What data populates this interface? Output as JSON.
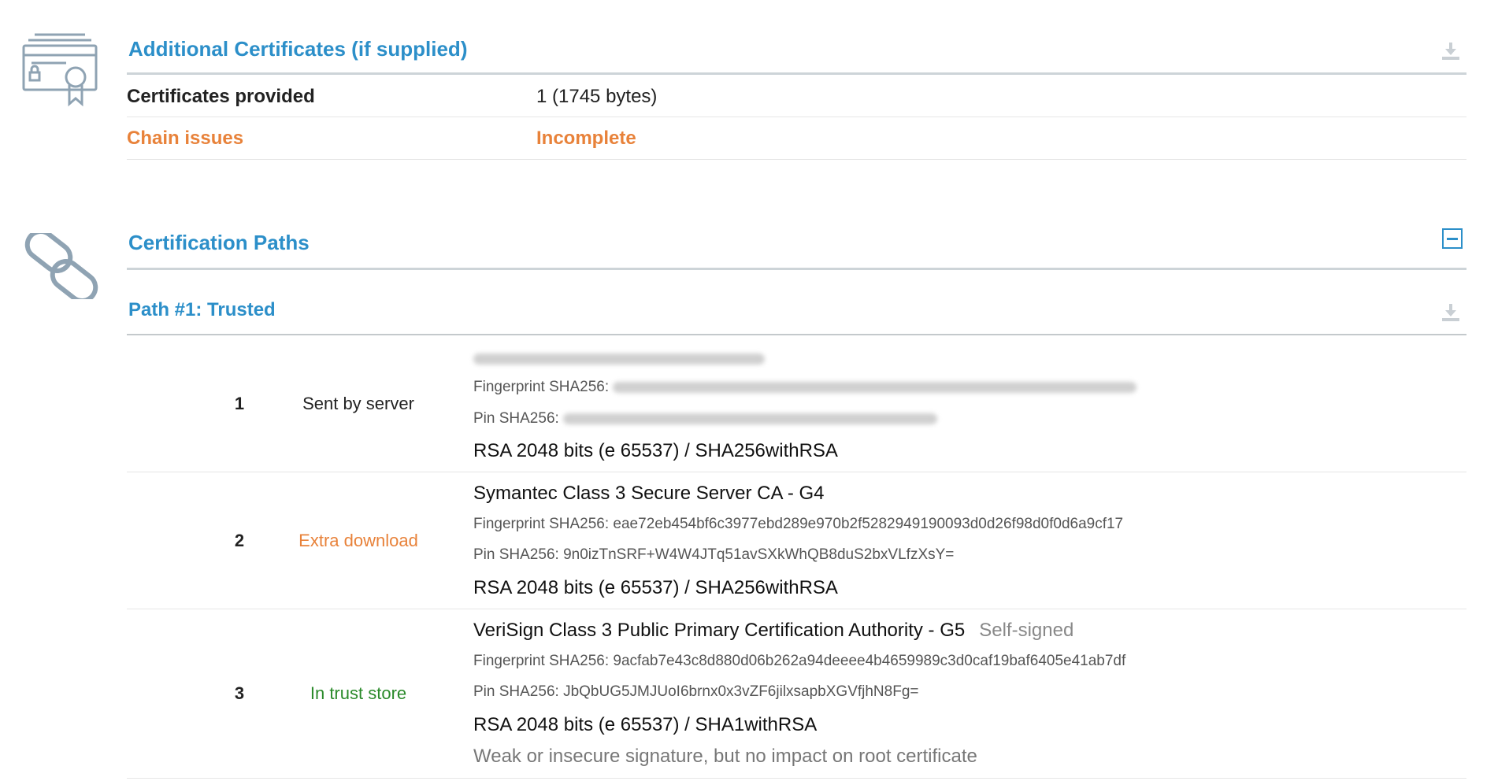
{
  "additional_certificates": {
    "title": "Additional Certificates (if supplied)",
    "rows": [
      {
        "label": "Certificates provided",
        "value": "1 (1745 bytes)"
      },
      {
        "label": "Chain issues",
        "value": "Incomplete"
      }
    ]
  },
  "certification_paths": {
    "title": "Certification Paths",
    "path_title": "Path #1: Trusted",
    "certs": [
      {
        "num": "1",
        "source": "Sent by server",
        "fingerprint_label": "Fingerprint SHA256:",
        "pin_label": "Pin SHA256:",
        "algo": "RSA 2048 bits (e 65537) / SHA256withRSA"
      },
      {
        "num": "2",
        "source": "Extra download",
        "name": "Symantec Class 3 Secure Server CA - G4",
        "fingerprint": "Fingerprint SHA256: eae72eb454bf6c3977ebd289e970b2f5282949190093d0d26f98d0f0d6a9cf17",
        "pin": "Pin SHA256: 9n0izTnSRF+W4W4JTq51avSXkWhQB8duS2bxVLfzXsY=",
        "algo": "RSA 2048 bits (e 65537) / SHA256withRSA"
      },
      {
        "num": "3",
        "source": "In trust store",
        "name": "VeriSign Class 3 Public Primary Certification Authority - G5",
        "self_signed": "Self-signed",
        "fingerprint": "Fingerprint SHA256: 9acfab7e43c8d880d06b262a94deeee4b4659989c3d0caf19baf6405e41ab7df",
        "pin": "Pin SHA256: JbQbUG5JMJUoI6brnx0x3vZF6jilxsapbXGVfjhN8Fg=",
        "algo": "RSA 2048 bits (e 65537) / SHA1withRSA",
        "warning": "Weak or insecure signature, but no impact on root certificate"
      }
    ]
  },
  "colors": {
    "accent": "#2c8fc9",
    "warning": "#e8823a",
    "trusted": "#2a8a2a"
  }
}
